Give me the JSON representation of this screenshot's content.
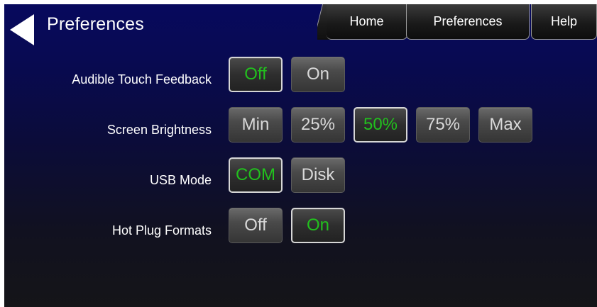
{
  "header": {
    "title": "Preferences",
    "back_icon": "back-arrow-icon"
  },
  "tabs": [
    {
      "label": "Home"
    },
    {
      "label": "Preferences"
    },
    {
      "label": "Help"
    }
  ],
  "settings": [
    {
      "label": "Audible Touch Feedback",
      "options": [
        "Off",
        "On"
      ],
      "selected": "Off"
    },
    {
      "label": "Screen Brightness",
      "options": [
        "Min",
        "25%",
        "50%",
        "75%",
        "Max"
      ],
      "selected": "50%"
    },
    {
      "label": "USB Mode",
      "options": [
        "COM",
        "Disk"
      ],
      "selected": "COM"
    },
    {
      "label": "Hot Plug Formats",
      "options": [
        "Off",
        "On"
      ],
      "selected": "On"
    }
  ],
  "colors": {
    "selected_text": "#22c01e",
    "background_top": "#07095d",
    "background_bottom": "#151518"
  }
}
